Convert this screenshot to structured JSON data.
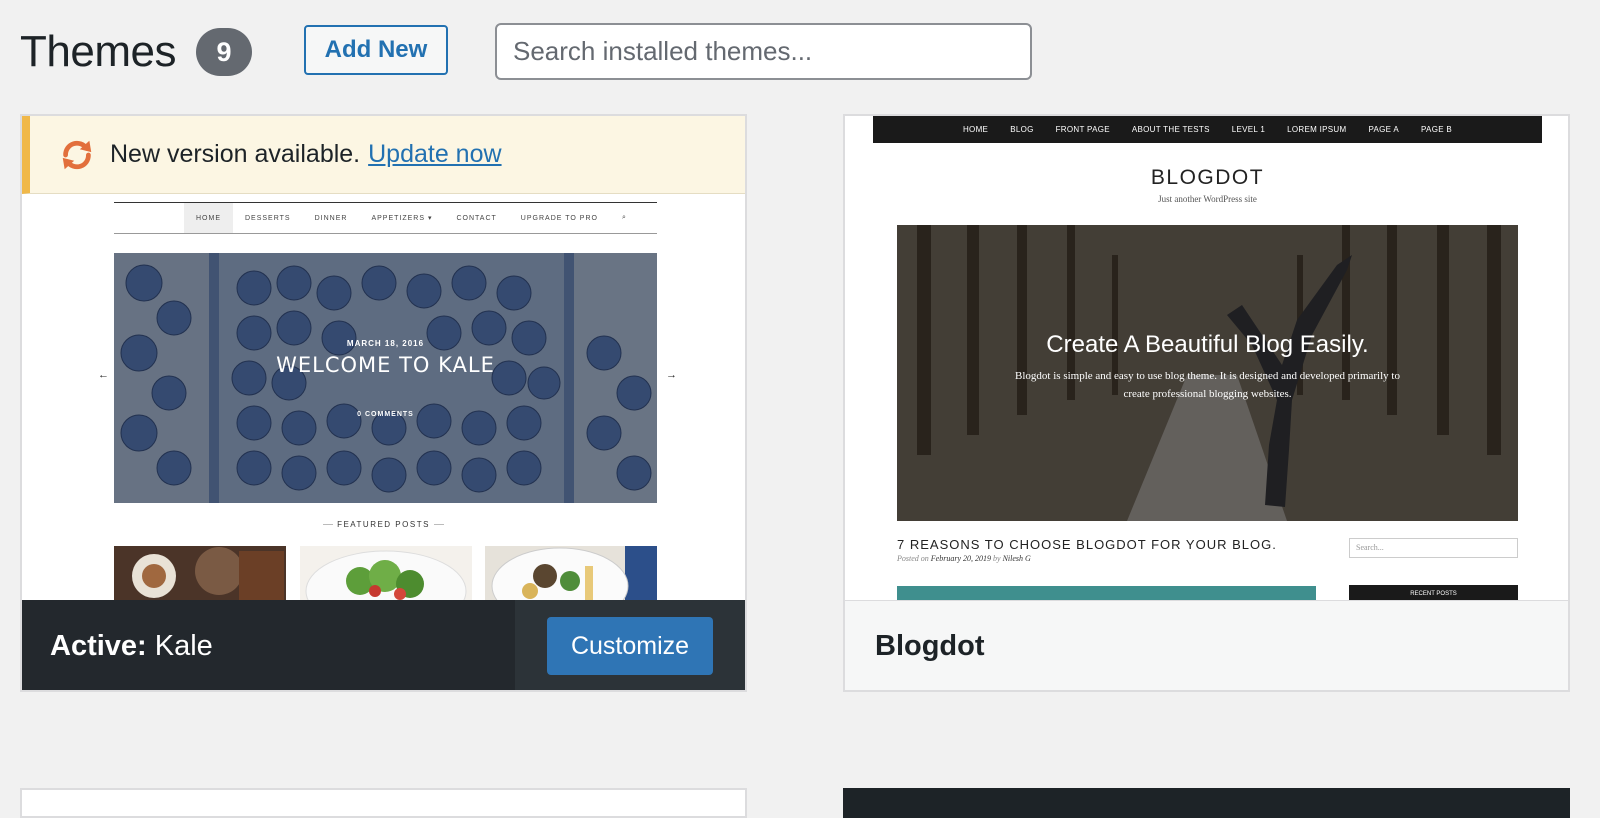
{
  "header": {
    "title": "Themes",
    "count": "9",
    "add_new_label": "Add New",
    "search_placeholder": "Search installed themes..."
  },
  "themes": [
    {
      "name": "Kale",
      "active_prefix": "Active:",
      "is_active": true,
      "action_label": "Customize",
      "notice": {
        "text": "New version available.",
        "link": "Update now",
        "icon": "update-icon"
      },
      "preview": {
        "nav": [
          "HOME",
          "DESSERTS",
          "DINNER",
          "APPETIZERS ▾",
          "CONTACT",
          "UPGRADE TO PRO",
          "⌕"
        ],
        "date": "MARCH 18, 2016",
        "title": "WELCOME TO KALE",
        "comments": "0 COMMENTS",
        "featured_label": "FEATURED POSTS",
        "arrow_left": "←",
        "arrow_right": "→"
      }
    },
    {
      "name": "Blogdot",
      "is_active": false,
      "preview": {
        "nav": [
          "HOME",
          "BLOG",
          "FRONT PAGE",
          "ABOUT THE TESTS",
          "LEVEL 1",
          "LOREM IPSUM",
          "PAGE A",
          "PAGE B"
        ],
        "logo": "BLOGDOT",
        "tagline": "Just another WordPress site",
        "hero_title": "Create A Beautiful Blog Easily.",
        "hero_text": "Blogdot is simple and easy to use blog theme. It is designed and developed primarily to create professional blogging websites.",
        "post_title": "7 REASONS TO CHOOSE BLOGDOT FOR YOUR BLOG.",
        "post_meta_prefix": "Posted on",
        "post_date": "February 20, 2019",
        "post_by": "by",
        "post_author": "Nilesh G",
        "search_placeholder": "Search...",
        "recent_posts": "RECENT POSTS"
      }
    }
  ],
  "colors": {
    "accent": "#2271b1",
    "notice_bg": "#fcf6e3",
    "notice_border": "#f0b849",
    "footer_dark": "#23282d",
    "badge": "#646970"
  }
}
